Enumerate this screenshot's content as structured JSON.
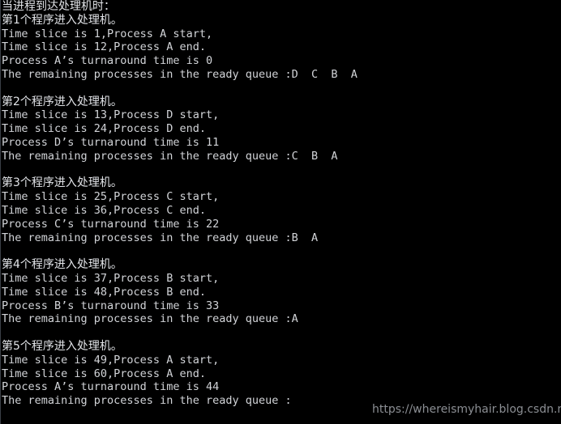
{
  "terminal": {
    "background_color": "#000000",
    "text_color": "#d2d4d8",
    "lines": [
      {
        "text": "当进程到达处理机时：",
        "type": "cjk"
      },
      {
        "text": "第1个程序进入处理机。",
        "type": "cjk"
      },
      {
        "text": "Time slice is 1,Process A start,",
        "type": "ascii"
      },
      {
        "text": "Time slice is 12,Process A end.",
        "type": "ascii"
      },
      {
        "text": "Process A’s turnaround time is 0",
        "type": "ascii"
      },
      {
        "text": "The remaining processes in the ready queue :D  C  B  A",
        "type": "ascii"
      },
      {
        "text": "",
        "type": "blank"
      },
      {
        "text": "第2个程序进入处理机。",
        "type": "cjk"
      },
      {
        "text": "Time slice is 13,Process D start,",
        "type": "ascii"
      },
      {
        "text": "Time slice is 24,Process D end.",
        "type": "ascii"
      },
      {
        "text": "Process D’s turnaround time is 11",
        "type": "ascii"
      },
      {
        "text": "The remaining processes in the ready queue :C  B  A",
        "type": "ascii"
      },
      {
        "text": "",
        "type": "blank"
      },
      {
        "text": "第3个程序进入处理机。",
        "type": "cjk"
      },
      {
        "text": "Time slice is 25,Process C start,",
        "type": "ascii"
      },
      {
        "text": "Time slice is 36,Process C end.",
        "type": "ascii"
      },
      {
        "text": "Process C’s turnaround time is 22",
        "type": "ascii"
      },
      {
        "text": "The remaining processes in the ready queue :B  A",
        "type": "ascii"
      },
      {
        "text": "",
        "type": "blank"
      },
      {
        "text": "第4个程序进入处理机。",
        "type": "cjk"
      },
      {
        "text": "Time slice is 37,Process B start,",
        "type": "ascii"
      },
      {
        "text": "Time slice is 48,Process B end.",
        "type": "ascii"
      },
      {
        "text": "Process B’s turnaround time is 33",
        "type": "ascii"
      },
      {
        "text": "The remaining processes in the ready queue :A",
        "type": "ascii"
      },
      {
        "text": "",
        "type": "blank"
      },
      {
        "text": "第5个程序进入处理机。",
        "type": "cjk"
      },
      {
        "text": "Time slice is 49,Process A start,",
        "type": "ascii"
      },
      {
        "text": "Time slice is 60,Process A end.",
        "type": "ascii"
      },
      {
        "text": "Process A’s turnaround time is 44",
        "type": "ascii"
      },
      {
        "text": "The remaining processes in the ready queue :",
        "type": "ascii"
      }
    ]
  },
  "watermark": {
    "text": "https://whereismyhair.blog.csdn.net",
    "color": "#8b8e93"
  }
}
